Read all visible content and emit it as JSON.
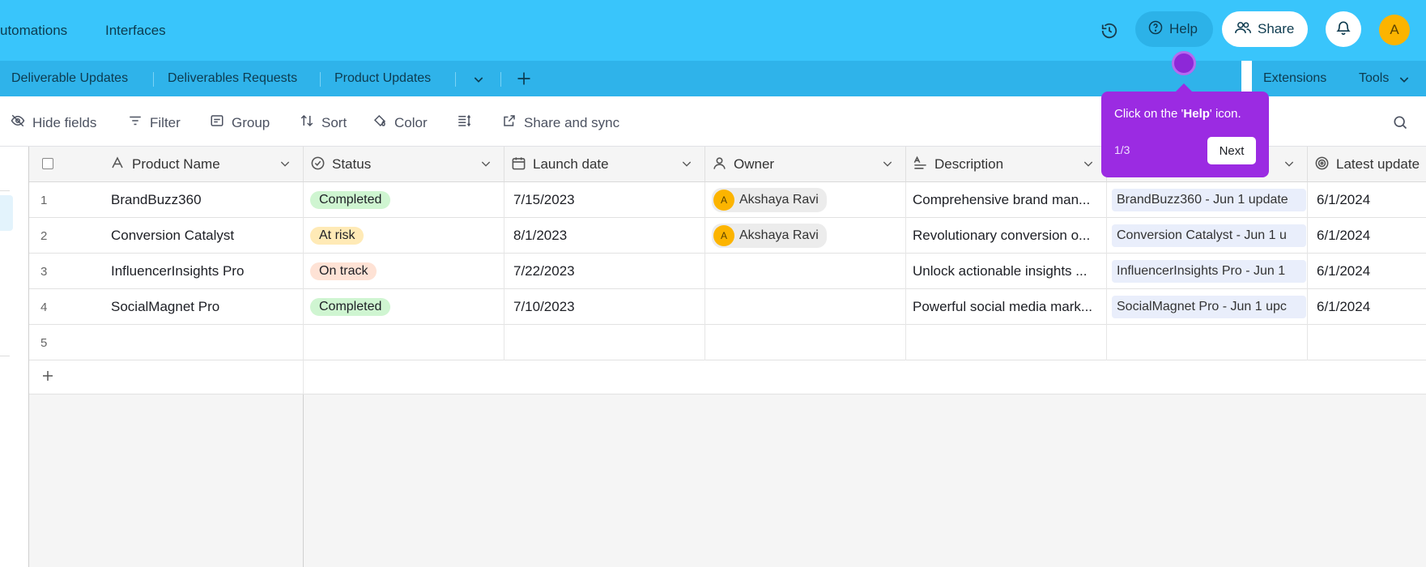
{
  "topbar": {
    "nav_automations": "utomations",
    "nav_interfaces": "Interfaces",
    "help_label": "Help",
    "share_label": "Share",
    "user_initial": "A"
  },
  "tabs": [
    {
      "label": "Deliverable Updates"
    },
    {
      "label": "Deliverables Requests"
    },
    {
      "label": "Product Updates"
    }
  ],
  "right_tabs": {
    "extensions": "Extensions",
    "tools": "Tools"
  },
  "toolbar": {
    "hide_fields": "Hide fields",
    "filter": "Filter",
    "group": "Group",
    "sort": "Sort",
    "color": "Color",
    "share_sync": "Share and sync"
  },
  "columns": {
    "product_name": "Product Name",
    "status": "Status",
    "launch_date": "Launch date",
    "owner": "Owner",
    "description": "Description",
    "latest_update": "Latest update"
  },
  "rows": [
    {
      "num": "1",
      "name": "BrandBuzz360",
      "status": "Completed",
      "date": "7/15/2023",
      "owner": "Akshaya Ravi",
      "owner_initial": "A",
      "description": "Comprehensive brand man...",
      "update": "BrandBuzz360 - Jun 1 update",
      "latest": "6/1/2024"
    },
    {
      "num": "2",
      "name": "Conversion Catalyst",
      "status": "At risk",
      "date": "8/1/2023",
      "owner": "Akshaya Ravi",
      "owner_initial": "A",
      "description": "Revolutionary conversion o...",
      "update": "Conversion Catalyst - Jun 1 u",
      "latest": "6/1/2024"
    },
    {
      "num": "3",
      "name": "InfluencerInsights Pro",
      "status": "On track",
      "date": "7/22/2023",
      "owner": "",
      "owner_initial": "",
      "description": "Unlock actionable insights ...",
      "update": "InfluencerInsights Pro - Jun 1",
      "latest": "6/1/2024"
    },
    {
      "num": "4",
      "name": "SocialMagnet Pro",
      "status": "Completed",
      "date": "7/10/2023",
      "owner": "",
      "owner_initial": "",
      "description": "Powerful social media mark...",
      "update": "SocialMagnet Pro - Jun 1 upc",
      "latest": "6/1/2024"
    },
    {
      "num": "5",
      "name": "",
      "status": "",
      "date": "",
      "owner": "",
      "owner_initial": "",
      "description": "",
      "update": "",
      "latest": ""
    }
  ],
  "status_colors": {
    "Completed": "#cff5d1",
    "At risk": "#ffeab6",
    "On track": "#fee2d5"
  },
  "tooltip": {
    "text_before": "Click on the '",
    "text_bold": "Help",
    "text_after": "' icon.",
    "step": "1/3",
    "next_label": "Next"
  },
  "colors": {
    "topbar": "#39c5fb",
    "tooltip": "#9b2be2"
  }
}
